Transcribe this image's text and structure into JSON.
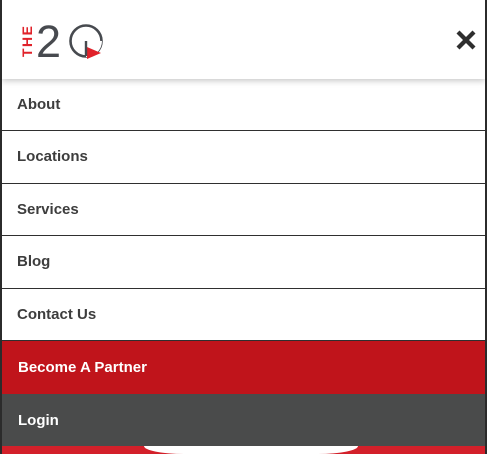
{
  "header": {
    "logo_text_vertical": "THE",
    "logo_number": "20",
    "close_icon": "close-x-icon"
  },
  "menu": {
    "items": [
      {
        "label": "About"
      },
      {
        "label": "Locations"
      },
      {
        "label": "Services"
      },
      {
        "label": "Blog"
      },
      {
        "label": "Contact Us"
      }
    ],
    "partner_label": "Become A Partner",
    "login_label": "Login"
  },
  "colors": {
    "brand_red": "#c0141b",
    "login_gray": "#4a4b4b",
    "logo_red": "#e0222a",
    "logo_gray": "#474a4f",
    "text_dark": "#3d3d3d"
  }
}
